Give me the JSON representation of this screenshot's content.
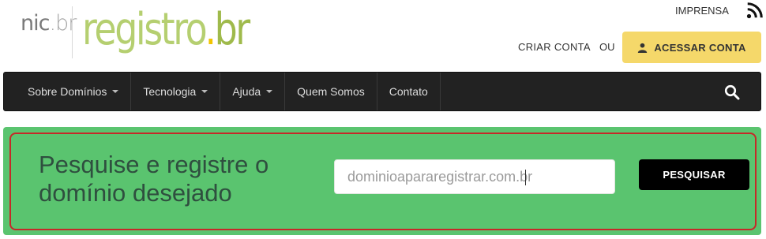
{
  "header": {
    "logo_nic": "nic",
    "logo_nic_suffix": ".br",
    "logo_registro": "registro",
    "logo_dot": ".",
    "logo_br": "br",
    "imprensa": "IMPRENSA",
    "criar_conta": "CRIAR CONTA",
    "ou": "OU",
    "acessar_conta": "ACESSAR CONTA"
  },
  "nav": {
    "items": [
      {
        "label": "Sobre Domínios",
        "dropdown": true
      },
      {
        "label": "Tecnologia",
        "dropdown": true
      },
      {
        "label": "Ajuda",
        "dropdown": true
      },
      {
        "label": "Quem Somos",
        "dropdown": false
      },
      {
        "label": "Contato",
        "dropdown": false
      }
    ]
  },
  "search": {
    "headline_line1": "Pesquise e registre o",
    "headline_line2": "domínio desejado",
    "input_value": "dominioapararegistrar.com.br",
    "placeholder": "dominioapararegistrar.com.br",
    "button_label": "PESQUISAR"
  },
  "colors": {
    "panel_green": "#5ac46f",
    "accent_yellow": "#f5d86a",
    "nav_dark": "#222222",
    "highlight_outline": "#c62828"
  },
  "icons": [
    "rss-icon",
    "user-icon",
    "search-icon",
    "caret-down-icon"
  ]
}
